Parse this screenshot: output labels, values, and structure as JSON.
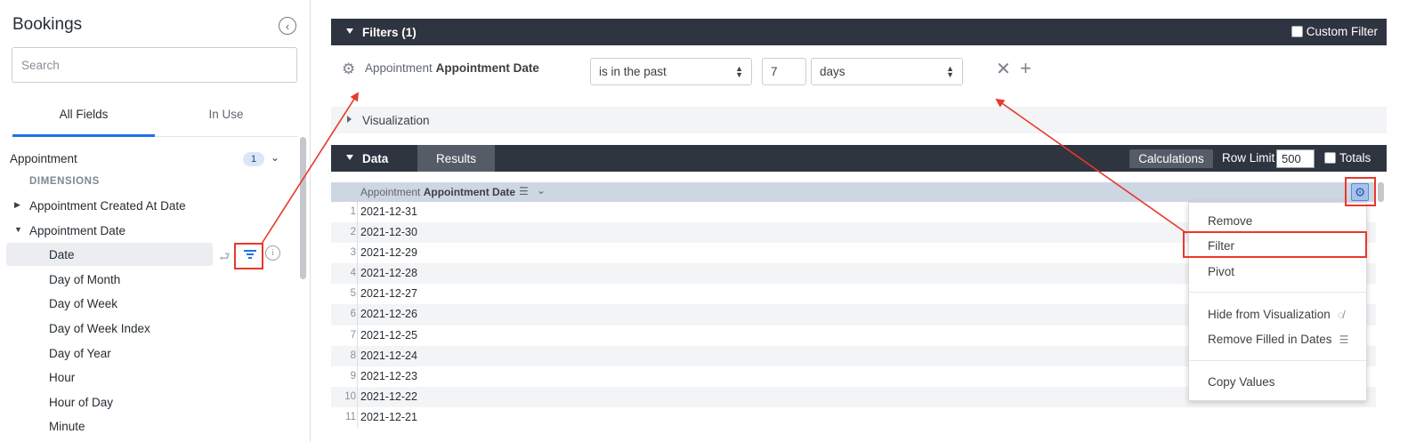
{
  "sidebar": {
    "title": "Bookings",
    "search_placeholder": "Search",
    "tabs": [
      {
        "label": "All Fields"
      },
      {
        "label": "In Use"
      }
    ],
    "view": {
      "label": "Appointment",
      "badge": "1"
    },
    "dimensions_heading": "DIMENSIONS",
    "fields": [
      {
        "label": "Appointment Created At Date"
      },
      {
        "label": "Appointment Date"
      }
    ],
    "children": [
      {
        "label": "Date"
      },
      {
        "label": "Day of Month"
      },
      {
        "label": "Day of Week"
      },
      {
        "label": "Day of Week Index"
      },
      {
        "label": "Day of Year"
      },
      {
        "label": "Hour"
      },
      {
        "label": "Hour of Day"
      },
      {
        "label": "Minute"
      }
    ]
  },
  "filters": {
    "title": "Filters (1)",
    "custom_filter_label": "Custom Filter",
    "field_view": "Appointment",
    "field_name": "Appointment Date",
    "condition": "is in the past",
    "amount": "7",
    "unit": "days"
  },
  "visualization": {
    "title": "Visualization"
  },
  "data": {
    "title": "Data",
    "results_tab": "Results",
    "calculations_label": "Calculations",
    "row_limit_label": "Row Limit",
    "row_limit_value": "500",
    "totals_label": "Totals",
    "column": {
      "view": "Appointment",
      "name": "Appointment Date"
    },
    "rows": [
      {
        "num": "1",
        "value": "2021-12-31"
      },
      {
        "num": "2",
        "value": "2021-12-30"
      },
      {
        "num": "3",
        "value": "2021-12-29"
      },
      {
        "num": "4",
        "value": "2021-12-28"
      },
      {
        "num": "5",
        "value": "2021-12-27"
      },
      {
        "num": "6",
        "value": "2021-12-26"
      },
      {
        "num": "7",
        "value": "2021-12-25"
      },
      {
        "num": "8",
        "value": "2021-12-24"
      },
      {
        "num": "9",
        "value": "2021-12-23"
      },
      {
        "num": "10",
        "value": "2021-12-22"
      },
      {
        "num": "11",
        "value": "2021-12-21"
      }
    ]
  },
  "menu": {
    "items": [
      {
        "label": "Remove"
      },
      {
        "label": "Filter"
      },
      {
        "label": "Pivot"
      },
      {
        "label": "Hide from Visualization"
      },
      {
        "label": "Remove Filled in Dates"
      },
      {
        "label": "Copy Values"
      }
    ]
  },
  "colors": {
    "accent": "#1a73e8",
    "header_bar": "#2f3441",
    "annotation": "#e8392a"
  }
}
